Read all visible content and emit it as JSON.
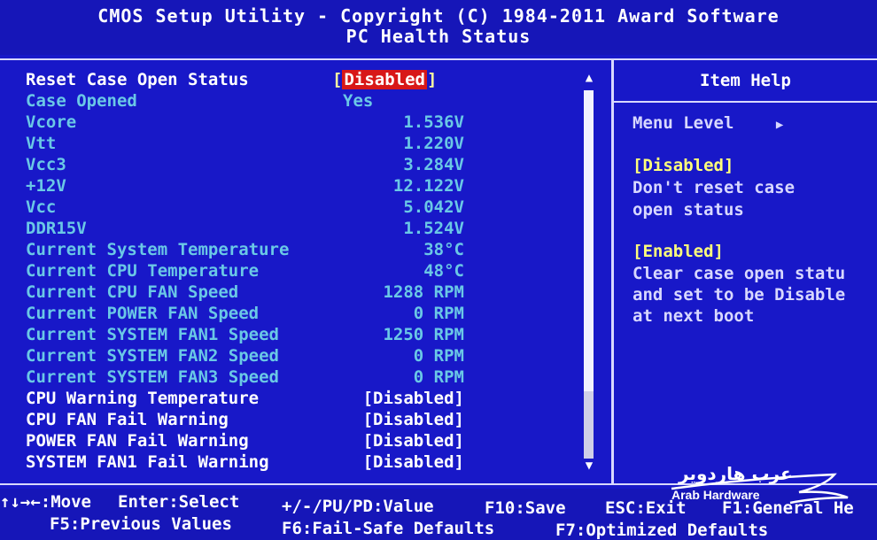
{
  "header": {
    "title": "CMOS Setup Utility - Copyright (C) 1984-2011 Award Software",
    "subtitle": "PC Health Status"
  },
  "items": [
    {
      "label": "Reset Case Open Status",
      "value": "Disabled",
      "bracketed": true,
      "highlighted": true,
      "active": true
    },
    {
      "label": "Case Opened",
      "value": "Yes",
      "active": false
    },
    {
      "label": "Vcore",
      "value": "1.536V",
      "active": false
    },
    {
      "label": "Vtt",
      "value": "1.220V",
      "active": false
    },
    {
      "label": "Vcc3",
      "value": "3.284V",
      "active": false
    },
    {
      "label": "+12V",
      "value": "12.122V",
      "active": false
    },
    {
      "label": "Vcc",
      "value": "5.042V",
      "active": false
    },
    {
      "label": "DDR15V",
      "value": "1.524V",
      "active": false
    },
    {
      "label": "Current System Temperature",
      "value": "38°C",
      "active": false
    },
    {
      "label": "Current CPU Temperature",
      "value": "48°C",
      "active": false
    },
    {
      "label": "Current CPU FAN Speed",
      "value": "1288 RPM",
      "active": false
    },
    {
      "label": "Current POWER FAN Speed",
      "value": "0 RPM",
      "active": false
    },
    {
      "label": "Current SYSTEM FAN1 Speed",
      "value": "1250 RPM",
      "active": false
    },
    {
      "label": "Current SYSTEM FAN2 Speed",
      "value": "0 RPM",
      "active": false
    },
    {
      "label": "Current SYSTEM FAN3 Speed",
      "value": "0 RPM",
      "active": false
    },
    {
      "label": "CPU Warning Temperature",
      "value": "[Disabled]",
      "active": true
    },
    {
      "label": "CPU FAN Fail Warning",
      "value": "[Disabled]",
      "active": true
    },
    {
      "label": "POWER FAN Fail Warning",
      "value": "[Disabled]",
      "active": true
    },
    {
      "label": "SYSTEM FAN1 Fail Warning",
      "value": "[Disabled]",
      "active": true
    }
  ],
  "help": {
    "title": "Item Help",
    "menu_level": "Menu Level",
    "menu_level_arrow": "▶",
    "lines": [
      {
        "text": "[Disabled]",
        "yellow": true
      },
      {
        "text": "Don't reset case",
        "yellow": false
      },
      {
        "text": "open status",
        "yellow": false
      },
      {
        "text": "",
        "yellow": false
      },
      {
        "text": "[Enabled]",
        "yellow": true
      },
      {
        "text": "Clear case open statu",
        "yellow": false
      },
      {
        "text": "and set to be Disable",
        "yellow": false
      },
      {
        "text": "at next boot",
        "yellow": false
      }
    ]
  },
  "footer": {
    "move": "↑↓→←:Move",
    "select": "Enter:Select",
    "value": "+/-/PU/PD:Value",
    "save": "F10:Save",
    "exit": "ESC:Exit",
    "help": "F1:General He",
    "prev": "F5:Previous Values",
    "failsafe": "F6:Fail-Safe Defaults",
    "optimized": "F7:Optimized Defaults"
  },
  "watermark": {
    "arabic": "عرب هاردوير",
    "latin": "Arab Hardware"
  },
  "colors": {
    "background": "#1818c8",
    "active_text": "#ffffff",
    "info_text": "#6ac8e6",
    "highlight": "#d81818",
    "help_heading": "#ffff7a"
  }
}
